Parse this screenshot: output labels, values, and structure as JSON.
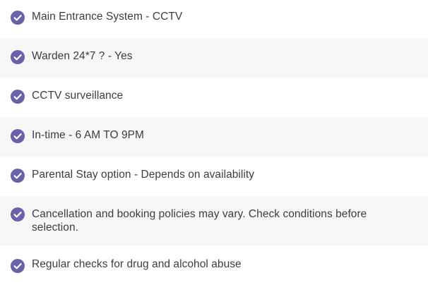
{
  "items": [
    {
      "label": "Main Entrance System - CCTV",
      "icon": "check-circle-icon"
    },
    {
      "label": "Warden 24*7 ? - Yes",
      "icon": "check-circle-icon"
    },
    {
      "label": "CCTV surveillance",
      "icon": "check-circle-icon"
    },
    {
      "label": "In-time - 6 AM TO 9PM",
      "icon": "check-circle-icon"
    },
    {
      "label": "Parental Stay option - Depends on availability",
      "icon": "check-circle-icon"
    },
    {
      "label": "Cancellation and booking policies may vary. Check conditions before selection.",
      "icon": "check-circle-icon"
    },
    {
      "label": "Regular checks for drug and alcohol abuse",
      "icon": "check-circle-icon"
    }
  ],
  "colors": {
    "icon_fill": "#6a62a8",
    "row_alt_background": "#f7f7f8",
    "text": "#3c3c44"
  }
}
